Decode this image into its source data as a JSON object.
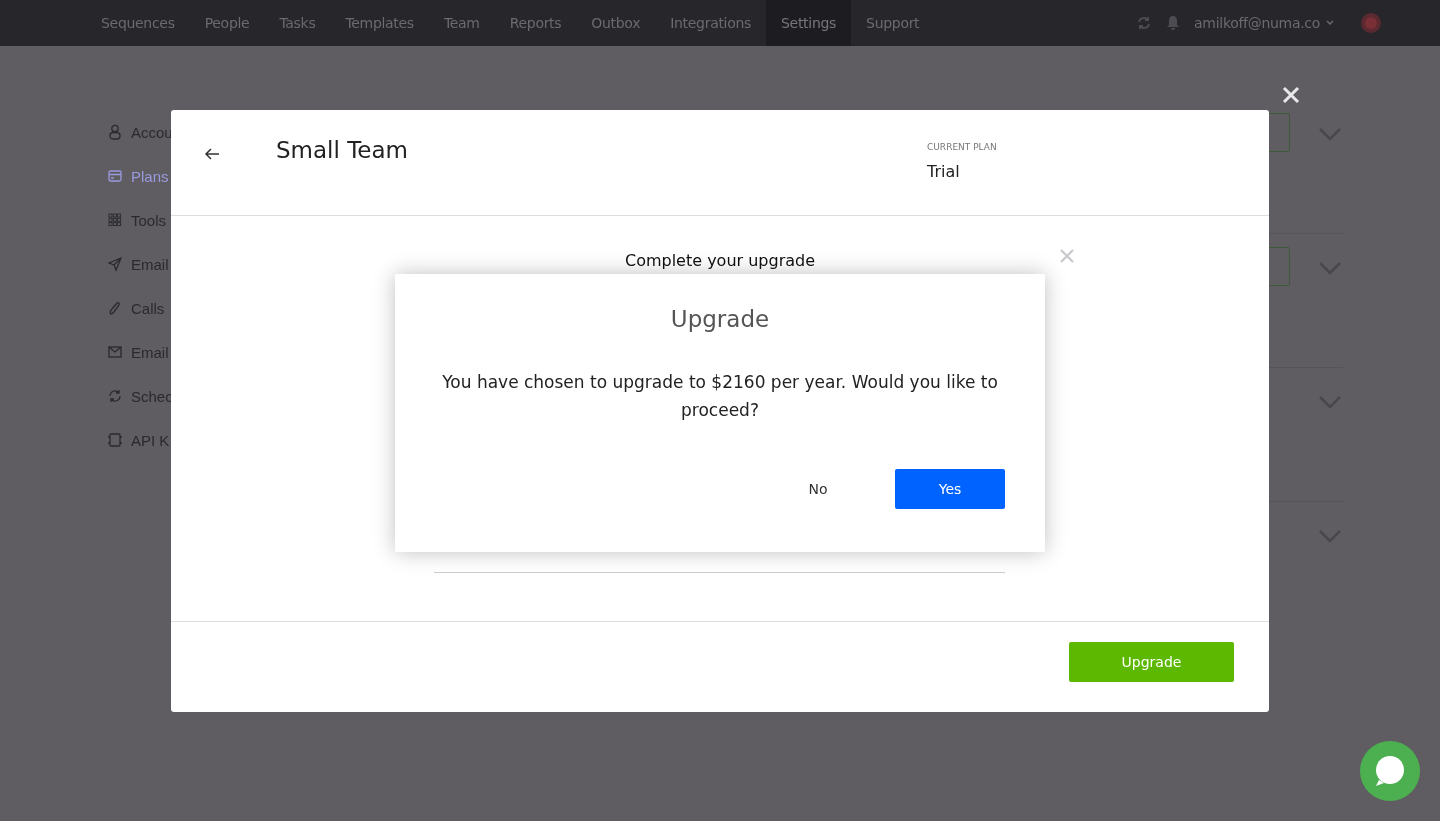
{
  "nav": {
    "items": [
      {
        "label": "Sequences",
        "selected": false
      },
      {
        "label": "People",
        "selected": false
      },
      {
        "label": "Tasks",
        "selected": false
      },
      {
        "label": "Templates",
        "selected": false
      },
      {
        "label": "Team",
        "selected": false
      },
      {
        "label": "Reports",
        "selected": false
      },
      {
        "label": "Outbox",
        "selected": false
      },
      {
        "label": "Integrations",
        "selected": false
      },
      {
        "label": "Settings",
        "selected": true
      },
      {
        "label": "Support",
        "selected": false
      }
    ],
    "user": "amilkoff@numa.co"
  },
  "sidebar": {
    "items": [
      {
        "label": "Accou",
        "selected": false
      },
      {
        "label": "Plans",
        "selected": true
      },
      {
        "label": "Tools",
        "selected": false
      },
      {
        "label": "Email",
        "selected": false
      },
      {
        "label": "Calls",
        "selected": false
      },
      {
        "label": "Email",
        "selected": false
      },
      {
        "label": "Schec",
        "selected": false
      },
      {
        "label": "API K",
        "selected": false
      }
    ]
  },
  "plan_modal": {
    "title": "Small Team",
    "current_plan_label": "CURRENT PLAN",
    "current_plan": "Trial",
    "section_title": "Complete your upgrade",
    "upgrade_button": "Upgrade"
  },
  "confirm_dialog": {
    "title": "Upgrade",
    "message": "You have chosen to upgrade to $2160 per year. Would you like to proceed?",
    "buttons": [
      {
        "label": "No",
        "kind": "secondary"
      },
      {
        "label": "Yes",
        "kind": "primary"
      }
    ]
  }
}
